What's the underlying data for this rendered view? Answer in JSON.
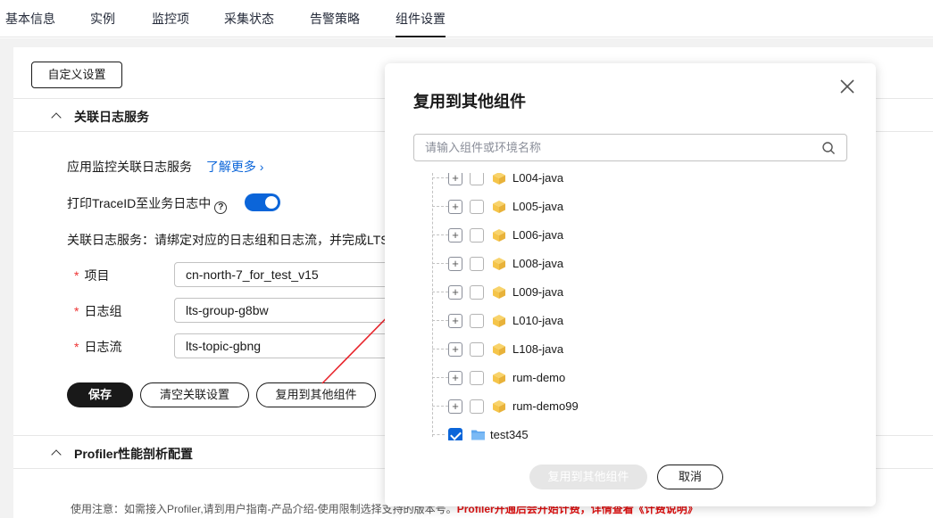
{
  "tabs": [
    {
      "label": "基本信息"
    },
    {
      "label": "实例"
    },
    {
      "label": "监控项"
    },
    {
      "label": "采集状态"
    },
    {
      "label": "告警策略"
    },
    {
      "label": "组件设置",
      "active": true
    }
  ],
  "page": {
    "custom_settings_button": "自定义设置",
    "section1": {
      "title": "关联日志服务",
      "app_monitor_label": "应用监控关联日志服务",
      "learn_more": "了解更多",
      "print_traceid_label": "打印TraceID至业务日志中",
      "toggle_on": true,
      "bind_hint": "关联日志服务：请绑定对应的日志组和日志流，并完成LTS",
      "fields": [
        {
          "label": "项目",
          "value": "cn-north-7_for_test_v15"
        },
        {
          "label": "日志组",
          "value": "lts-group-g8bw"
        },
        {
          "label": "日志流",
          "value": "lts-topic-gbng"
        }
      ],
      "save_button": "保存",
      "clear_button": "清空关联设置",
      "reuse_button": "复用到其他组件"
    },
    "section2": {
      "title": "Profiler性能剖析配置",
      "note_prefix": "使用注意：如需接入Profiler,请到用户指南-产品介绍-使用限制选择支持的版本号。",
      "note_red": "Profiler开通后会开始计费，详情查看《计费说明》"
    }
  },
  "modal": {
    "title": "复用到其他组件",
    "search_placeholder": "请输入组件或环境名称",
    "tree_items": [
      {
        "label": "L004-java",
        "type": "component",
        "checked": false
      },
      {
        "label": "L005-java",
        "type": "component",
        "checked": false
      },
      {
        "label": "L006-java",
        "type": "component",
        "checked": false
      },
      {
        "label": "L008-java",
        "type": "component",
        "checked": false
      },
      {
        "label": "L009-java",
        "type": "component",
        "checked": false
      },
      {
        "label": "L010-java",
        "type": "component",
        "checked": false
      },
      {
        "label": "L108-java",
        "type": "component",
        "checked": false
      },
      {
        "label": "rum-demo",
        "type": "component",
        "checked": false
      },
      {
        "label": "rum-demo99",
        "type": "component",
        "checked": false
      },
      {
        "label": "test345",
        "type": "folder",
        "checked": true
      }
    ],
    "confirm_button": "复用到其他组件",
    "cancel_button": "取消"
  },
  "colors": {
    "primary": "#0b65d9",
    "accent_red": "#e33",
    "cube_yellow": "#f5c54a",
    "folder_blue": "#5fa7ee"
  }
}
